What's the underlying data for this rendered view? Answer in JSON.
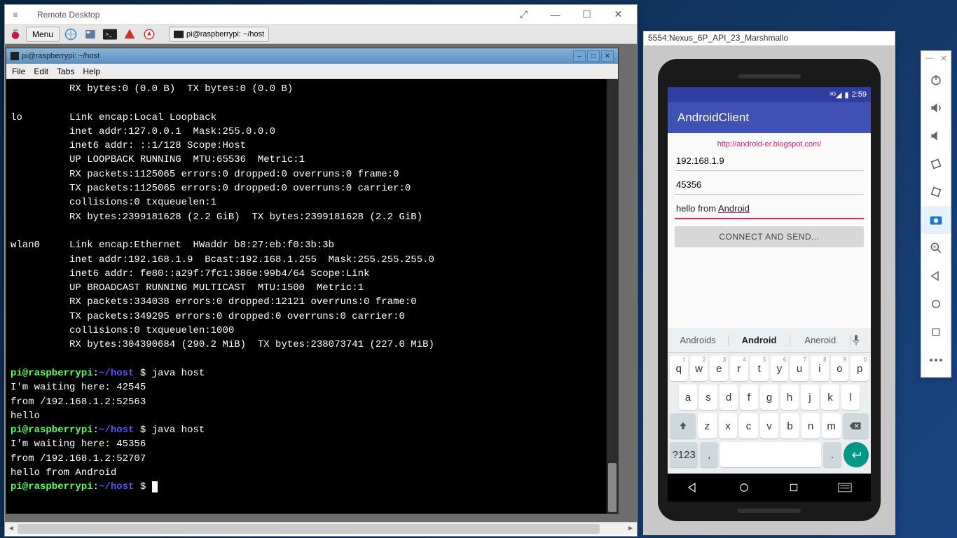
{
  "rdp": {
    "title": "Remote Desktop",
    "controls": {
      "resize": "⤢",
      "min": "—",
      "max": "☐",
      "close": "✕"
    }
  },
  "pi_taskbar": {
    "menu_label": "Menu",
    "task_item": "pi@raspberrypi: ~/host"
  },
  "terminal": {
    "title": "pi@raspberrypi: ~/host",
    "menus": {
      "file": "File",
      "edit": "Edit",
      "tabs": "Tabs",
      "help": "Help"
    },
    "lines": [
      "          RX bytes:0 (0.0 B)  TX bytes:0 (0.0 B)",
      "",
      "lo        Link encap:Local Loopback",
      "          inet addr:127.0.0.1  Mask:255.0.0.0",
      "          inet6 addr: ::1/128 Scope:Host",
      "          UP LOOPBACK RUNNING  MTU:65536  Metric:1",
      "          RX packets:1125065 errors:0 dropped:0 overruns:0 frame:0",
      "          TX packets:1125065 errors:0 dropped:0 overruns:0 carrier:0",
      "          collisions:0 txqueuelen:1",
      "          RX bytes:2399181628 (2.2 GiB)  TX bytes:2399181628 (2.2 GiB)",
      "",
      "wlan0     Link encap:Ethernet  HWaddr b8:27:eb:f0:3b:3b",
      "          inet addr:192.168.1.9  Bcast:192.168.1.255  Mask:255.255.255.0",
      "          inet6 addr: fe80::a29f:7fc1:386e:99b4/64 Scope:Link",
      "          UP BROADCAST RUNNING MULTICAST  MTU:1500  Metric:1",
      "          RX packets:334038 errors:0 dropped:12121 overruns:0 frame:0",
      "          TX packets:349295 errors:0 dropped:0 overruns:0 carrier:0",
      "          collisions:0 txqueuelen:1000",
      "          RX bytes:304390684 (290.2 MiB)  TX bytes:238073741 (227.0 MiB)",
      ""
    ],
    "prompts": [
      {
        "user": "pi@raspberrypi",
        "path": "~/host",
        "cmd": "java host"
      },
      {
        "plain": "I'm waiting here: 42545"
      },
      {
        "plain": "from /192.168.1.2:52563"
      },
      {
        "plain": "hello"
      },
      {
        "user": "pi@raspberrypi",
        "path": "~/host",
        "cmd": "java host"
      },
      {
        "plain": "I'm waiting here: 45356"
      },
      {
        "plain": "from /192.168.1.2:52707"
      },
      {
        "plain": "hello from Android"
      },
      {
        "user": "pi@raspberrypi",
        "path": "~/host",
        "cmd": "",
        "cursor": true
      }
    ]
  },
  "emulator": {
    "title": "5554:Nexus_6P_API_23_Marshmallo",
    "status_time": "2:59",
    "app_title": "AndroidClient",
    "url_label": "http://android-er.blogspot.com/",
    "ip": "192.168.1.9",
    "port": "45356",
    "msg_prefix": "hello from ",
    "msg_underline": "Android",
    "button": "CONNECT AND SEND...",
    "suggest": {
      "left": "Androids",
      "center": "Android",
      "right": "Aneroid"
    },
    "keys_row1": [
      {
        "l": "q",
        "s": "1"
      },
      {
        "l": "w",
        "s": "2"
      },
      {
        "l": "e",
        "s": "3"
      },
      {
        "l": "r",
        "s": "4"
      },
      {
        "l": "t",
        "s": "5"
      },
      {
        "l": "y",
        "s": "6"
      },
      {
        "l": "u",
        "s": "7"
      },
      {
        "l": "i",
        "s": "8"
      },
      {
        "l": "o",
        "s": "9"
      },
      {
        "l": "p",
        "s": "0"
      }
    ],
    "keys_row2": [
      "a",
      "s",
      "d",
      "f",
      "g",
      "h",
      "j",
      "k",
      "l"
    ],
    "keys_row3": [
      "z",
      "x",
      "c",
      "v",
      "b",
      "n",
      "m"
    ],
    "sym_key": "?123"
  },
  "toolbar_icons": [
    "power",
    "vol-up",
    "vol-down",
    "rotate-left",
    "rotate-right",
    "camera",
    "zoom",
    "back",
    "circle",
    "square",
    "more"
  ]
}
